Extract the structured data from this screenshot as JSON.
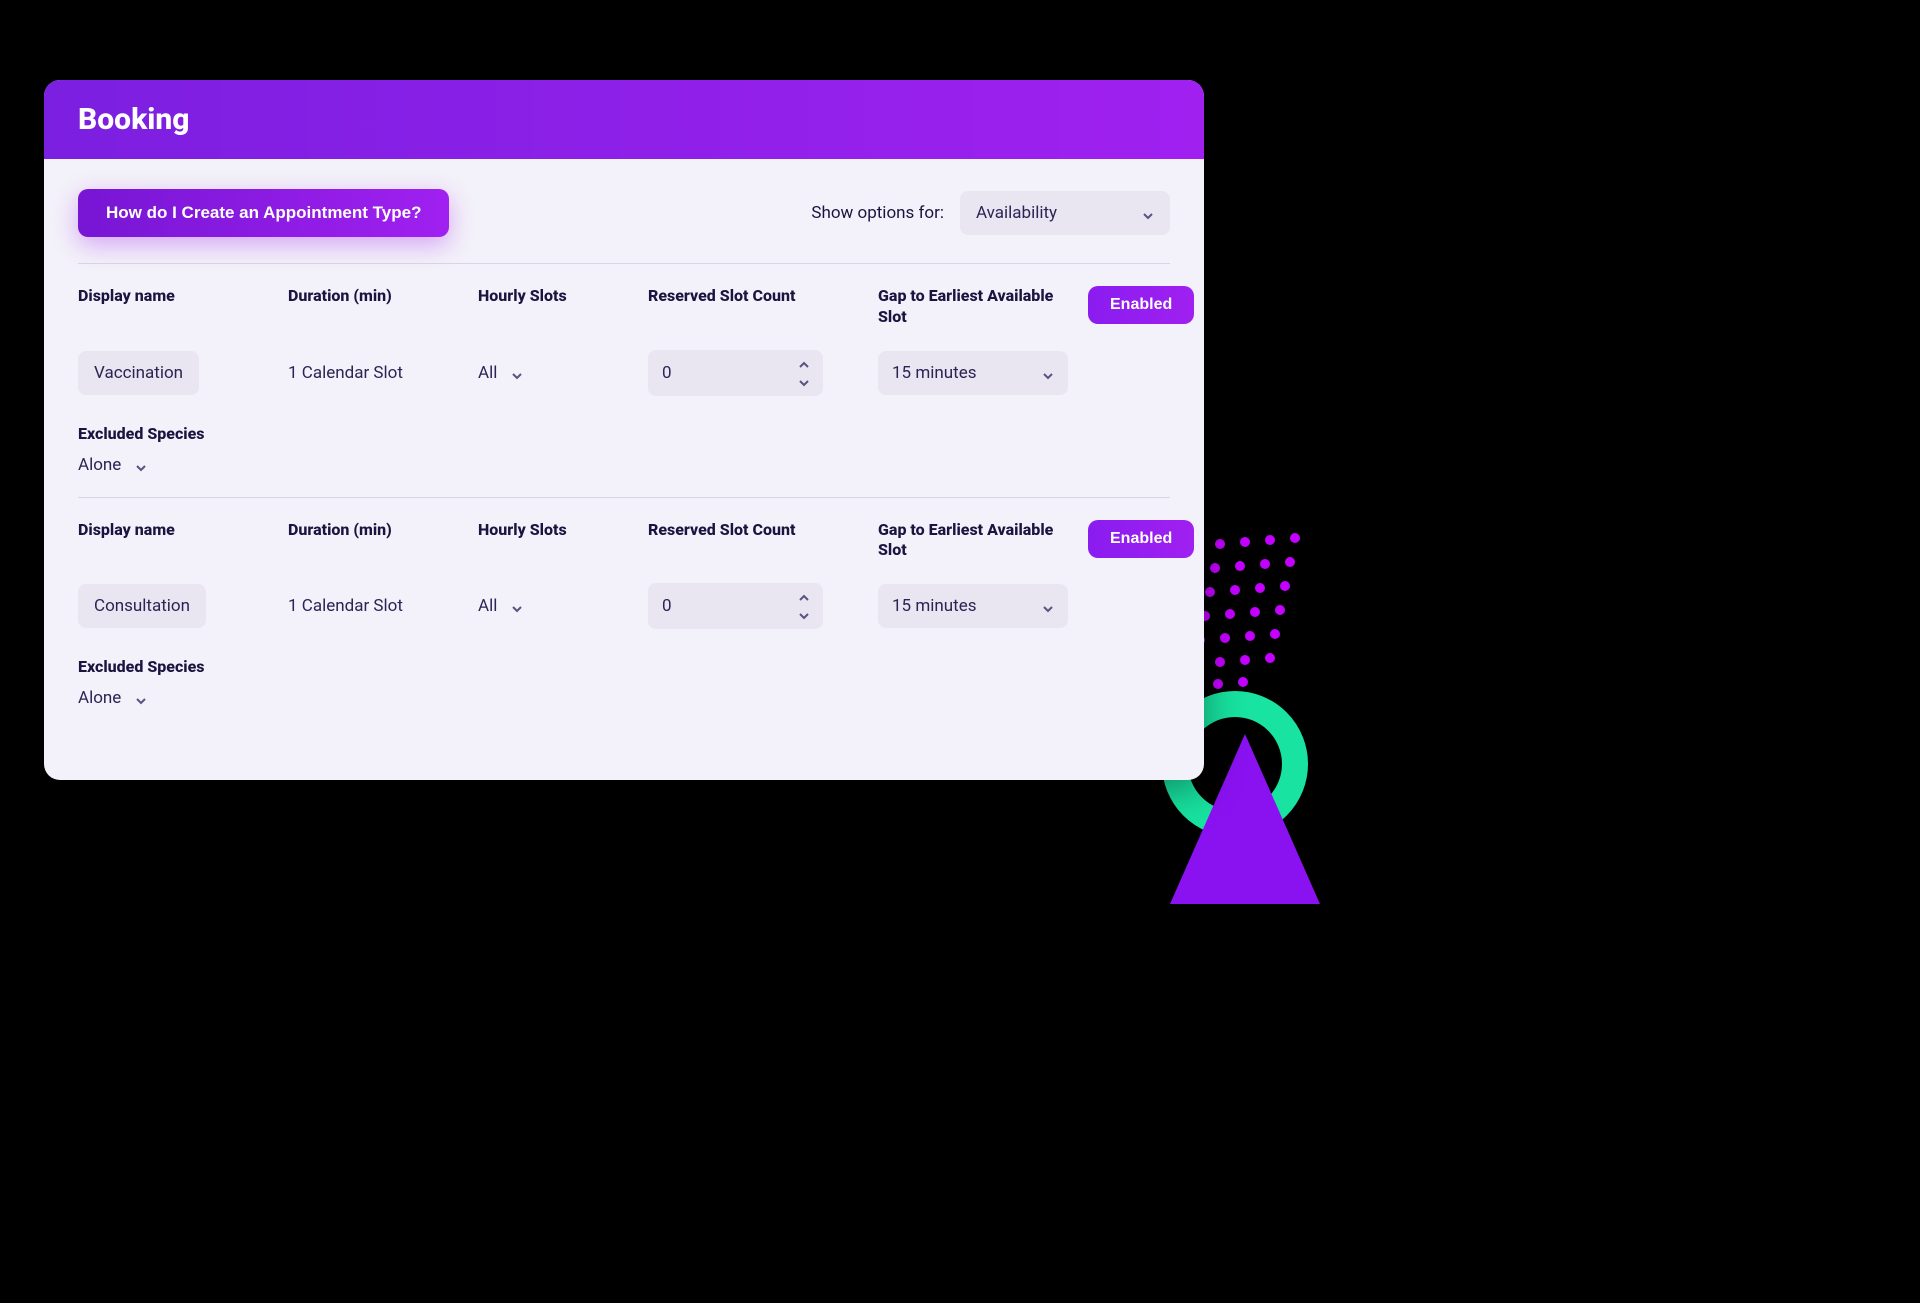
{
  "header": {
    "title": "Booking"
  },
  "toolbar": {
    "help_label": "How do I Create an Appointment Type?",
    "show_options_label": "Show options for:",
    "show_options_value": "Availability"
  },
  "columns": {
    "display_name": "Display name",
    "duration": "Duration (min)",
    "hourly_slots": "Hourly Slots",
    "reserved_slot_count": "Reserved Slot Count",
    "gap_earliest": "Gap to Earliest Available Slot",
    "enabled": "Enabled"
  },
  "excluded_label": "Excluded Species",
  "rows": [
    {
      "display_name": "Vaccination",
      "duration": "1 Calendar Slot",
      "hourly_slots": "All",
      "reserved_slot_count": "0",
      "gap": "15 minutes",
      "enabled_label": "Enabled",
      "excluded_value": "Alone"
    },
    {
      "display_name": "Consultation",
      "duration": "1 Calendar Slot",
      "hourly_slots": "All",
      "reserved_slot_count": "0",
      "gap": "15 minutes",
      "enabled_label": "Enabled",
      "excluded_value": "Alone"
    }
  ]
}
